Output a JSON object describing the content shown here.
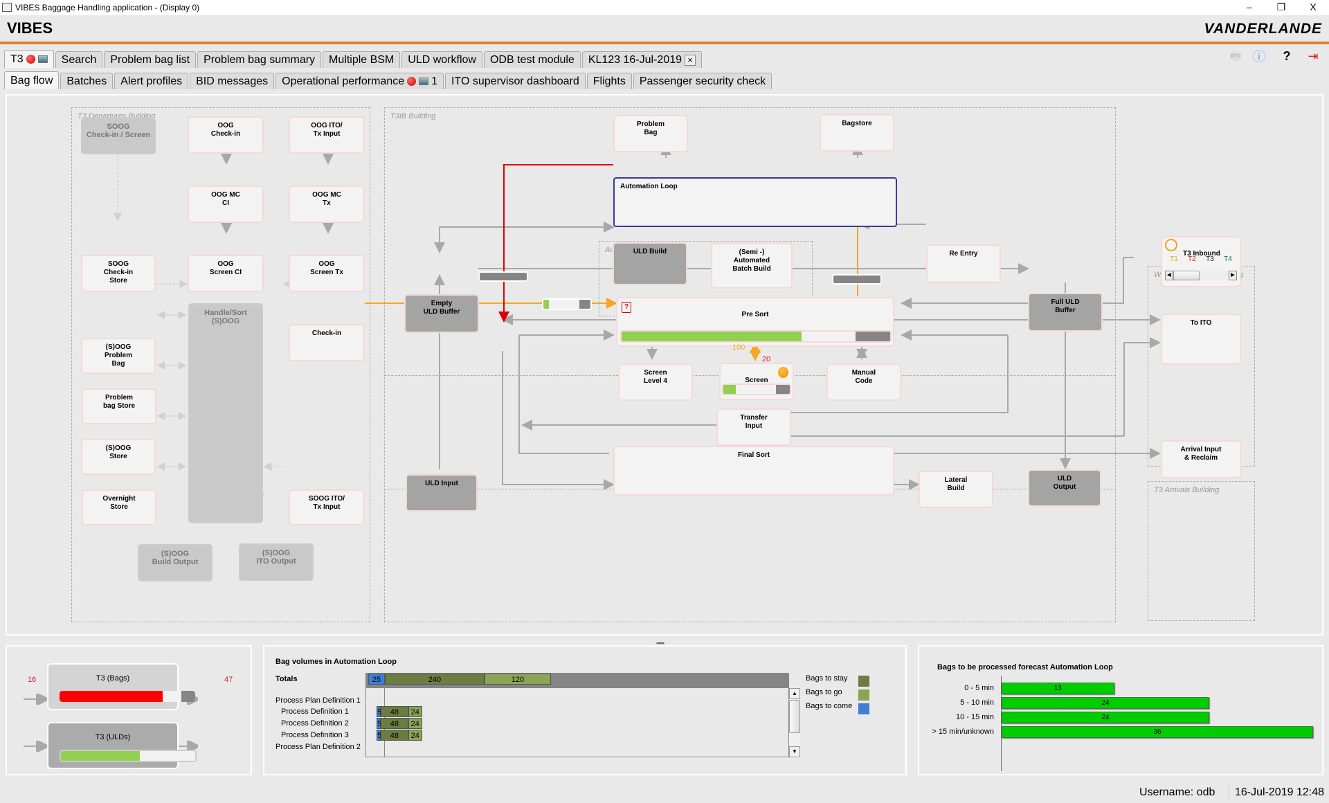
{
  "window": {
    "title": "VIBES Baggage Handling application - (Display 0)",
    "minimize": "–",
    "restore": "❐",
    "close": "X"
  },
  "header": {
    "brand": "VIBES",
    "logo": "VANDERLANDE"
  },
  "top_tabs": [
    {
      "label": "T3",
      "active": true,
      "alert": true
    },
    {
      "label": "Search"
    },
    {
      "label": "Problem bag list"
    },
    {
      "label": "Problem bag summary"
    },
    {
      "label": "Multiple BSM"
    },
    {
      "label": "ULD workflow"
    },
    {
      "label": "ODB test module"
    },
    {
      "label": "KL123 16-Jul-2019",
      "closable": true,
      "close_glyph": "×"
    }
  ],
  "header_icons": {
    "print": "🖶",
    "info": "i",
    "help": "?",
    "exit": "⇥"
  },
  "sub_tabs": [
    {
      "label": "Bag flow",
      "active": true
    },
    {
      "label": "Batches"
    },
    {
      "label": "Alert profiles"
    },
    {
      "label": "BID messages"
    },
    {
      "label": "Operational performance",
      "alert": true,
      "count": "1"
    },
    {
      "label": "ITO supervisor dashboard"
    },
    {
      "label": "Flights"
    },
    {
      "label": "Passenger security check"
    }
  ],
  "zones": {
    "t3dep": "T3 Departures Building",
    "t3ib": "T3IB Building",
    "automation": "Automation",
    "western": "Western Interface Building",
    "arrivals": "T3 Arrivals Building"
  },
  "nodes": {
    "soog_checkin_screen": "SOOG\nCheck-in / Screen",
    "oog_checkin": "OOG\nCheck-in",
    "oog_ito_tx": "OOG ITO/\nTx Input",
    "oog_mc_ci": "OOG MC\nCI",
    "oog_mc_tx": "OOG MC\nTx",
    "soog_checkin_store": "SOOG\nCheck-in\nStore",
    "oog_screen_ci": "OOG\nScreen CI",
    "oog_screen_tx": "OOG\nScreen Tx",
    "handle_sort": "Handle/Sort\n(S)OOG",
    "checkin": "Check-in",
    "soog_problem_bag": "(S)OOG\nProblem\nBag",
    "problem_bag_store": "Problem\nbag Store",
    "soog_store": "(S)OOG\nStore",
    "overnight_store": "Overnight\nStore",
    "soog_ito_tx": "SOOG ITO/\nTx Input",
    "soog_build_output": "(S)OOG\nBuild Output",
    "soog_ito_output": "(S)OOG\nITO Output",
    "problem_bag": "Problem\nBag",
    "bagstore": "Bagstore",
    "automation_loop": "Automation Loop",
    "uld_build": "ULD Build",
    "semi_auto": "(Semi -)\nAutomated\nBatch Build",
    "re_entry": "Re Entry",
    "empty_uld_buffer": "Empty\nULD Buffer",
    "full_uld_buffer": "Full ULD\nBuffer",
    "pre_sort": "Pre Sort",
    "screen_l4": "Screen\nLevel 4",
    "screen": "Screen",
    "manual_code": "Manual\nCode",
    "transfer_input": "Transfer\nInput",
    "final_sort": "Final Sort",
    "lateral_build": "Lateral\nBuild",
    "uld_input": "ULD Input",
    "uld_output": "ULD\nOutput",
    "t3_inbound": "T3 Inbound",
    "to_ito": "To ITO",
    "arrival_reclaim": "Arrival Input\n& Reclaim"
  },
  "t3_inbound_terminals": [
    {
      "label": "T1",
      "color": "#e8a020"
    },
    {
      "label": "T2",
      "color": "#d02020"
    },
    {
      "label": "T3",
      "color": "#222222"
    },
    {
      "label": "T4",
      "color": "#226655"
    }
  ],
  "flow_values": {
    "screen_up": "100",
    "screen_down": "20"
  },
  "fill_levels": {
    "pre_sort": 0.67,
    "checkin_conveyor": 0.12,
    "screen": 0.19
  },
  "summary": {
    "bags": {
      "label": "T3 (Bags)",
      "in": "16",
      "out": "47",
      "fill": 0.76
    },
    "ulds": {
      "label": "T3 (ULDs)",
      "fill": 0.59
    }
  },
  "bag_volumes": {
    "title": "Bag volumes in Automation Loop",
    "rows": [
      {
        "label": "Totals",
        "bold": true,
        "come": 25,
        "stay": 240,
        "go": 120
      },
      {
        "label": "Process Plan Definition 1",
        "group": true
      },
      {
        "label": "Process Definition 1",
        "come": 5,
        "stay": 48,
        "go": 24
      },
      {
        "label": "Process Definition 2",
        "come": 5,
        "stay": 48,
        "go": 24
      },
      {
        "label": "Process Definition 3",
        "come": 5,
        "stay": 48,
        "go": 24
      },
      {
        "label": "Process Plan Definition 2",
        "group": true
      }
    ],
    "legend": [
      {
        "label": "Bags to stay",
        "color": "#6b7d40"
      },
      {
        "label": "Bags to go",
        "color": "#8aa553"
      },
      {
        "label": "Bags to come",
        "color": "#3d7fd6"
      }
    ]
  },
  "forecast": {
    "title": "Bags to be processed forecast Automation Loop",
    "rows": [
      {
        "label": "0 - 5 min",
        "value": 13
      },
      {
        "label": "5 - 10 min",
        "value": 24
      },
      {
        "label": "10 - 15 min",
        "value": 24
      },
      {
        "label": "> 15 min/unknown",
        "value": 36
      }
    ],
    "color": "#00cc00"
  },
  "status": {
    "username": "Username: odb",
    "datetime": "16-Jul-2019 12:48"
  }
}
